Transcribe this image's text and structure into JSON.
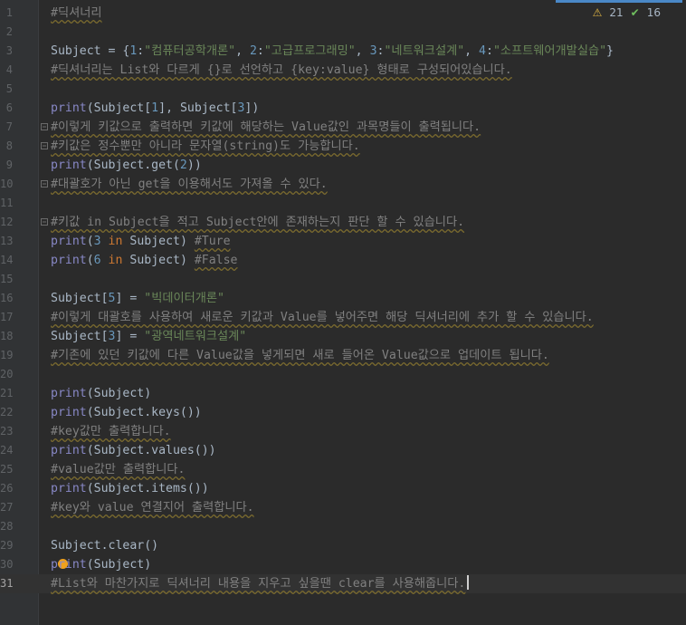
{
  "inspections": {
    "warnings": "21",
    "weak_warnings": "16"
  },
  "line_numbers": [
    "1",
    "2",
    "3",
    "4",
    "5",
    "6",
    "7",
    "8",
    "9",
    "10",
    "11",
    "12",
    "13",
    "14",
    "15",
    "16",
    "17",
    "18",
    "19",
    "20",
    "21",
    "22",
    "23",
    "24",
    "25",
    "26",
    "27",
    "28",
    "29",
    "30",
    "31"
  ],
  "code": {
    "l1": "#딕셔너리",
    "l3_a": "Subject = {",
    "l3_k1": "1",
    "l3_v1": "\"컴퓨터공학개론\"",
    "l3_sep1": ", ",
    "l3_k2": "2",
    "l3_v2": "\"고급프로그래밍\"",
    "l3_sep2": ", ",
    "l3_k3": "3",
    "l3_v3": "\"네트워크설계\"",
    "l3_sep3": ", ",
    "l3_k4": "4",
    "l3_v4": "\"소프트웨어개발실습\"",
    "l3_end": "}",
    "l4": "#딕셔너리는 List와 다르게 {}로 선언하고 {key:value} 형태로 구성되어있습니다.",
    "l6_p": "print",
    "l6_a": "(Subject[",
    "l6_n1": "1",
    "l6_b": "], Subject[",
    "l6_n2": "3",
    "l6_c": "])",
    "l7": "#이렇게 키값으로 출력하면 키값에 해당하는 Value값인 과목명들이 출력됩니다.",
    "l8": "#키값은 정수뿐만 아니라 문자열(string)도 가능합니다.",
    "l9_p": "print",
    "l9_a": "(Subject.get(",
    "l9_n": "2",
    "l9_b": "))",
    "l10": "#대괄호가 아닌 get을 이용해서도 가져올 수 있다.",
    "l12": "#키값 in Subject을 적고 Subject안에 존재하는지 판단 할 수 있습니다.",
    "l13_p": "print",
    "l13_a": "(",
    "l13_n": "3",
    "l13_in": " in",
    "l13_b": " Subject) ",
    "l13_c": "#Ture",
    "l14_p": "print",
    "l14_a": "(",
    "l14_n": "6",
    "l14_in": " in",
    "l14_b": " Subject) ",
    "l14_c": "#False",
    "l16_a": "Subject[",
    "l16_n": "5",
    "l16_b": "] = ",
    "l16_s": "\"빅데이터개론\"",
    "l17": "#이렇게 대괄호를 사용하여 새로운 키값과 Value를 넣어주면 해당 딕셔너리에 추가 할 수 있습니다.",
    "l18_a": "Subject[",
    "l18_n": "3",
    "l18_b": "] = ",
    "l18_s": "\"광역네트워크설계\"",
    "l19": "#기존에 있던 키값에 다른 Value값을 넣게되면 새로 들어온 Value값으로 업데이트 됩니다.",
    "l21_p": "print",
    "l21_a": "(Subject)",
    "l22_p": "print",
    "l22_a": "(Subject.keys())",
    "l23": "#key값만 출력합니다.",
    "l24_p": "print",
    "l24_a": "(Subject.values())",
    "l25": "#value값만 출력합니다.",
    "l26_p": "print",
    "l26_a": "(Subject.items())",
    "l27": "#key와 value 연결지어 출력합니다.",
    "l29": "Subject.clear()",
    "l30_p": "print",
    "l30_a": "(Subject)",
    "l31": "#List와 마찬가지로 딕셔너리 내용을 지우고 싶을땐 clear를 사용해줍니다."
  }
}
